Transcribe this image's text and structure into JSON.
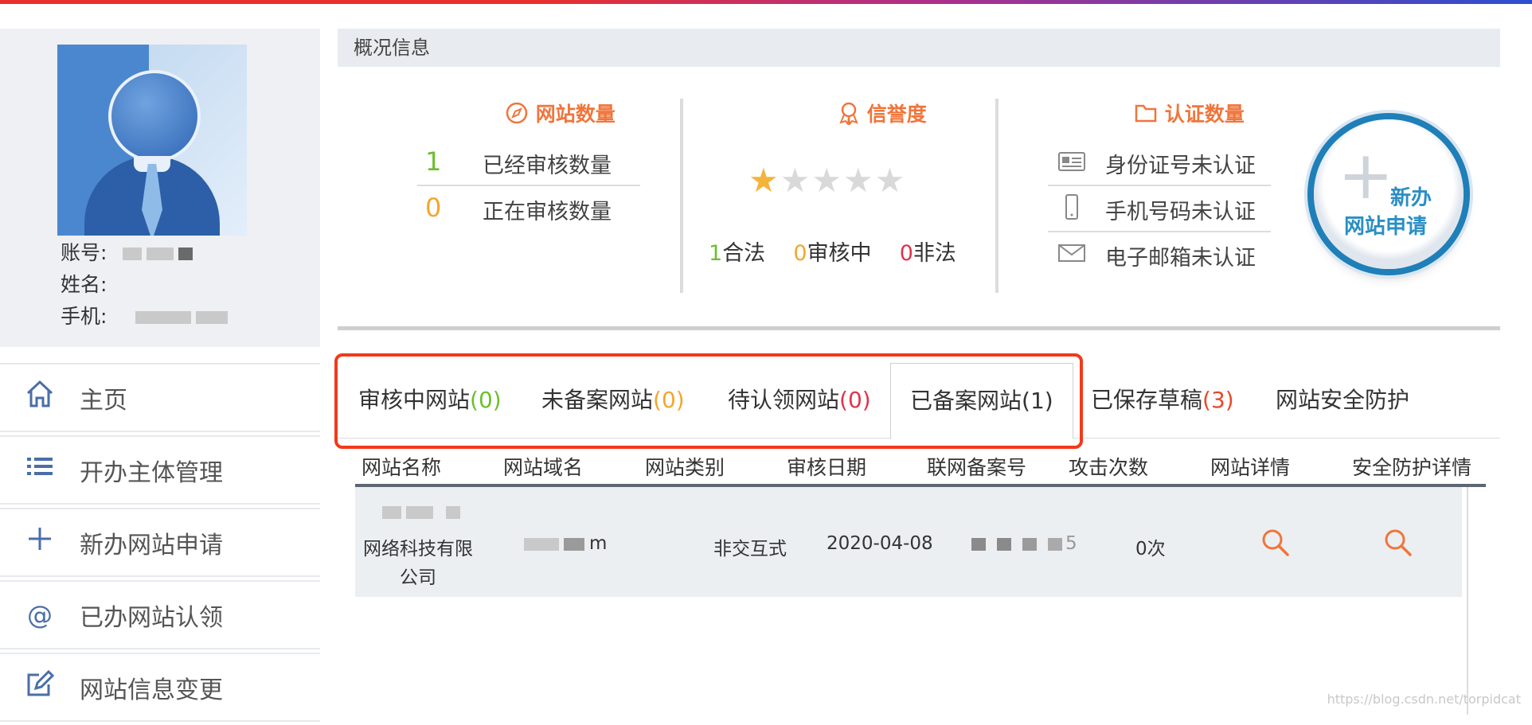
{
  "profile": {
    "account_label": "账号:",
    "name_label": "姓名:",
    "phone_label": "手机:"
  },
  "menu": {
    "items": [
      {
        "label": "主页",
        "icon": "home-icon"
      },
      {
        "label": "开办主体管理",
        "icon": "list-icon"
      },
      {
        "label": "新办网站申请",
        "icon": "plus-icon"
      },
      {
        "label": "已办网站认领",
        "icon": "at-icon"
      },
      {
        "label": "网站信息变更",
        "icon": "edit-icon"
      }
    ]
  },
  "summary": {
    "title": "概况信息",
    "site_count": {
      "title": "网站数量",
      "approved_num": "1",
      "approved_label": "已经审核数量",
      "reviewing_num": "0",
      "reviewing_label": "正在审核数量"
    },
    "reputation": {
      "title": "信誉度",
      "stars_filled": 1,
      "stars_total": 5,
      "legal_num": "1",
      "legal_label": "合法",
      "reviewing_num": "0",
      "reviewing_label": "审核中",
      "illegal_num": "0",
      "illegal_label": "非法"
    },
    "certification": {
      "title": "认证数量",
      "id_label": "身份证号未认证",
      "phone_label": "手机号码未认证",
      "email_label": "电子邮箱未认证"
    },
    "new_button": {
      "line1": "新办",
      "line2": "网站申请"
    }
  },
  "tabs": [
    {
      "label": "审核中网站",
      "count": "(0)",
      "count_color": "#6abf2f"
    },
    {
      "label": "未备案网站",
      "count": "(0)",
      "count_color": "#f2a72c"
    },
    {
      "label": "待认领网站",
      "count": "(0)",
      "count_color": "#e0334c"
    },
    {
      "label": "已备案网站",
      "count": "(1)",
      "count_color": "#333333"
    },
    {
      "label": "已保存草稿",
      "count": "(3)",
      "count_color": "#e8492a"
    },
    {
      "label": "网站安全防护",
      "count": "",
      "count_color": "#333333"
    }
  ],
  "table": {
    "headers": [
      "网站名称",
      "网站域名",
      "网站类别",
      "审核日期",
      "联网备案号",
      "攻击次数",
      "网站详情",
      "安全防护详情"
    ],
    "row": {
      "name_line1": "网络科技有限",
      "name_line2": "公司",
      "domain_suffix": "m",
      "category": "非交互式",
      "date": "2020-04-08",
      "record_suffix": "5",
      "attacks": "0次"
    }
  },
  "watermark": "https://blog.csdn.net/torpidcat",
  "colors": {
    "accent": "#f0753b",
    "highlight_border": "#f23a1a",
    "menu_icon": "#4a6ea8"
  }
}
